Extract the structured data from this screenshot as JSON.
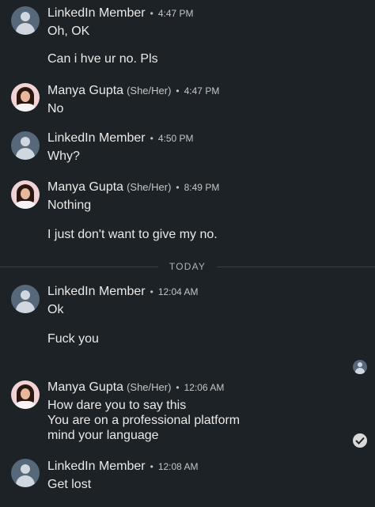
{
  "messages": [
    {
      "sender": "LinkedIn Member",
      "pronouns": "",
      "time": "4:47 PM",
      "avatar": "member-avatar",
      "lines": [
        "Oh, OK",
        "Can i hve ur no. Pls"
      ]
    },
    {
      "sender": "Manya Gupta",
      "pronouns": "(She/Her)",
      "time": "4:47 PM",
      "avatar": "profile-photo",
      "lines": [
        "No"
      ]
    },
    {
      "sender": "LinkedIn Member",
      "pronouns": "",
      "time": "4:50 PM",
      "avatar": "member-avatar",
      "lines": [
        "Why?"
      ]
    },
    {
      "sender": "Manya Gupta",
      "pronouns": "(She/Her)",
      "time": "8:49 PM",
      "avatar": "profile-photo",
      "lines": [
        "Nothing",
        "I just don't want to give my no."
      ]
    },
    {
      "sender": "LinkedIn Member",
      "pronouns": "",
      "time": "12:04 AM",
      "avatar": "member-avatar",
      "lines": [
        "Ok",
        "Fuck you"
      ]
    },
    {
      "sender": "Manya Gupta",
      "pronouns": "(She/Her)",
      "time": "12:06 AM",
      "avatar": "profile-photo",
      "lines": [
        "How dare you to say this",
        "You are on a professional platform",
        "mind your language"
      ]
    },
    {
      "sender": "LinkedIn Member",
      "pronouns": "",
      "time": "12:08 AM",
      "avatar": "member-avatar",
      "lines": [
        "Get lost"
      ]
    }
  ],
  "divider": {
    "label": "TODAY"
  },
  "seen_receipt_icon": "seen-avatar-icon",
  "sent_status_icon": "check-circle-icon",
  "colors": {
    "background": "#1d2226",
    "text": "#e9e9e9",
    "meta": "#c3c6c8"
  }
}
